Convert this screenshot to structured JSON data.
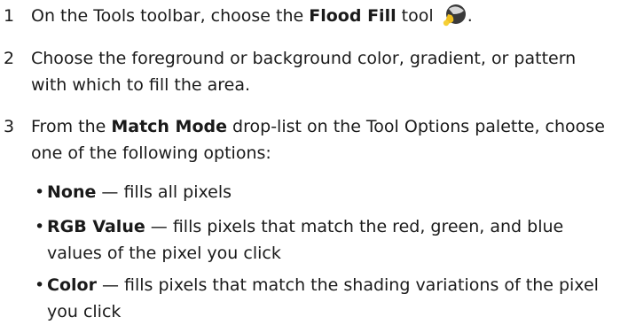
{
  "steps": [
    {
      "number": "1",
      "before": "On the Tools toolbar, choose the ",
      "bold": "Flood Fill",
      "after": " tool",
      "icon": "flood-fill-icon",
      "end": "."
    },
    {
      "number": "2",
      "text": "Choose the foreground or background color, gradient, or pattern with which to fill the area."
    },
    {
      "number": "3",
      "before": "From the ",
      "bold": "Match Mode",
      "after": " drop-list on the Tool Options palette, choose one of the following options:"
    }
  ],
  "options": [
    {
      "bullet": "•",
      "term": "None",
      "dash": " — ",
      "desc": "fills all pixels"
    },
    {
      "bullet": "•",
      "term": "RGB Value",
      "dash": " — ",
      "desc": "fills pixels that match the red, green, and blue values of the pixel you click"
    },
    {
      "bullet": "•",
      "term": "Color",
      "dash": " — ",
      "desc": "fills pixels that match the shading variations of the pixel you click"
    }
  ],
  "colors": {
    "text": "#1a1a1a",
    "icon_bucket_dark": "#3a3a3a",
    "icon_paint": "#f0c020"
  }
}
